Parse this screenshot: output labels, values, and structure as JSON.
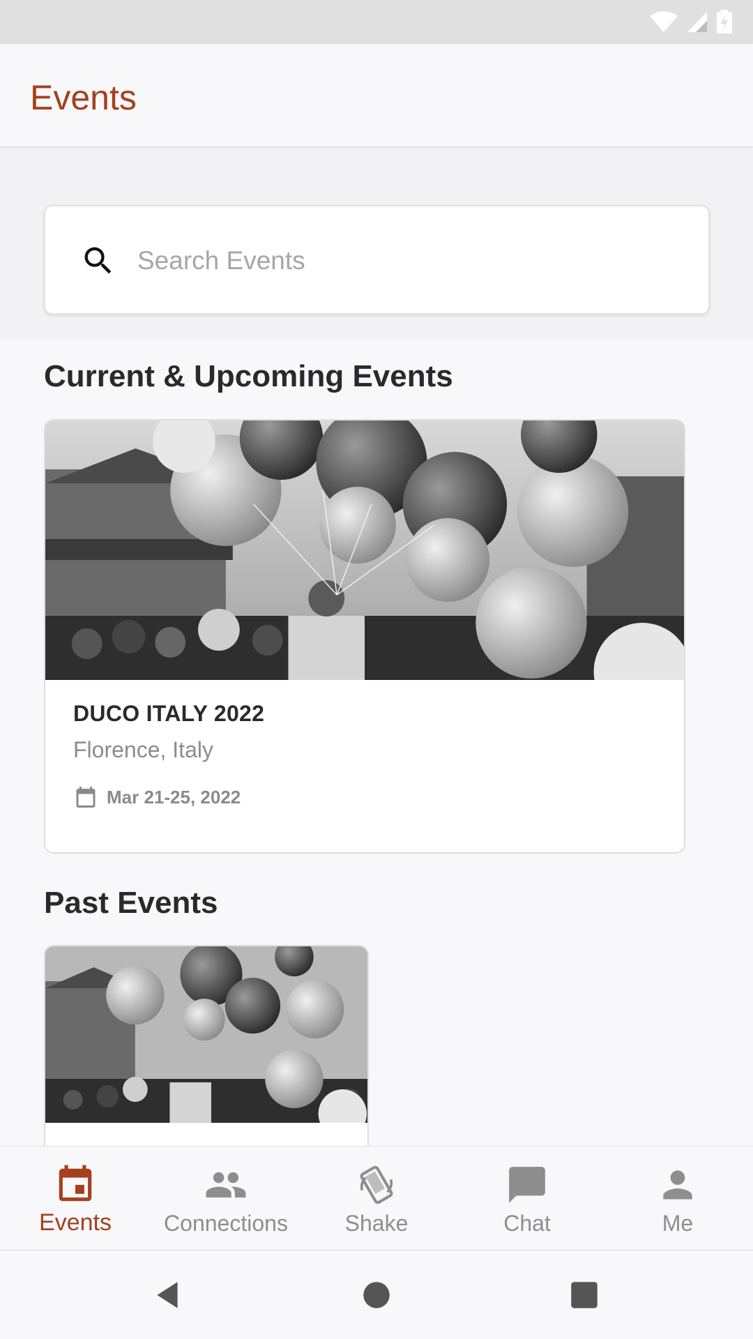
{
  "app_bar": {
    "title": "Events"
  },
  "search": {
    "placeholder": "Search Events",
    "value": ""
  },
  "sections": {
    "current_title": "Current & Upcoming Events",
    "past_title": "Past Events"
  },
  "current_events": [
    {
      "name": "DUCO ITALY 2022",
      "location": "Florence, Italy",
      "date": "Mar 21-25, 2022"
    }
  ],
  "past_events": [
    {
      "name": "",
      "location": "",
      "date": ""
    }
  ],
  "bottom_nav": {
    "items": [
      {
        "label": "Events",
        "icon": "calendar-icon",
        "active": true
      },
      {
        "label": "Connections",
        "icon": "people-icon",
        "active": false
      },
      {
        "label": "Shake",
        "icon": "shake-phone-icon",
        "active": false
      },
      {
        "label": "Chat",
        "icon": "chat-bubble-icon",
        "active": false
      },
      {
        "label": "Me",
        "icon": "person-icon",
        "active": false
      }
    ]
  },
  "colors": {
    "accent": "#a5401e",
    "inactive": "#8e8e8e",
    "background": "#f8f8fa"
  }
}
